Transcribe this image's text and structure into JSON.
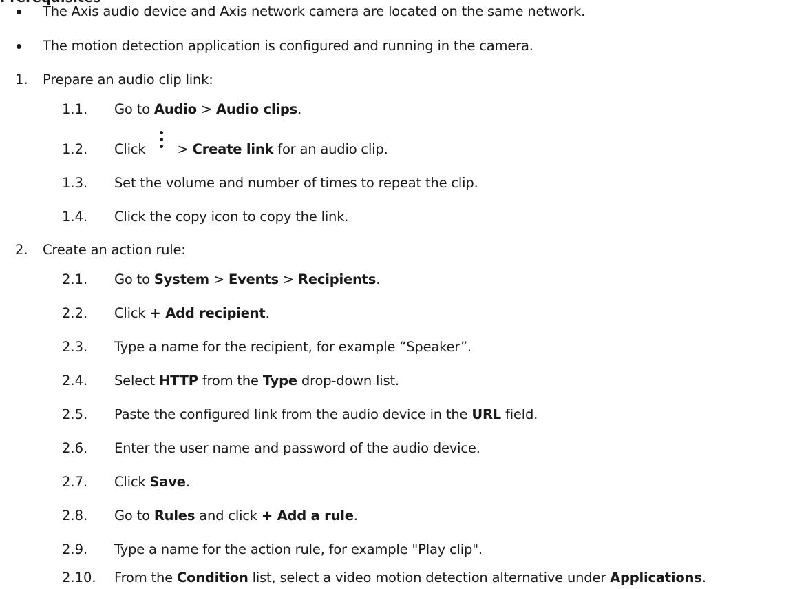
{
  "heading_partial": "Prerequisites",
  "prerequisites": [
    "The Axis audio device and Axis network camera are located on the same network.",
    "The motion detection application is configured and running in the camera."
  ],
  "steps": [
    {
      "num": "1.",
      "text": "Prepare an audio clip link:",
      "substeps": [
        {
          "num": "1.1.",
          "parts": [
            "Go to ",
            "Audio",
            " > ",
            "Audio clips",
            "."
          ]
        },
        {
          "num": "1.2.",
          "parts": [
            "Click ",
            " > ",
            "Create link",
            " for an audio clip."
          ]
        },
        {
          "num": "1.3.",
          "parts": [
            "Set the volume and number of times to repeat the clip."
          ]
        },
        {
          "num": "1.4.",
          "parts": [
            "Click the copy icon to copy the link."
          ]
        }
      ]
    },
    {
      "num": "2.",
      "text": "Create an action rule:",
      "substeps": [
        {
          "num": "2.1.",
          "parts": [
            "Go to ",
            "System",
            " > ",
            "Events",
            " > ",
            "Recipients",
            "."
          ]
        },
        {
          "num": "2.2.",
          "parts": [
            "Click ",
            "+ Add recipient",
            "."
          ]
        },
        {
          "num": "2.3.",
          "parts": [
            "Type a name for the recipient, for example “Speaker”."
          ]
        },
        {
          "num": "2.4.",
          "parts": [
            "Select ",
            "HTTP",
            " from the ",
            "Type",
            " drop-down list."
          ]
        },
        {
          "num": "2.5.",
          "parts": [
            "Paste the configured link from the audio device in the ",
            "URL",
            " field."
          ]
        },
        {
          "num": "2.6.",
          "parts": [
            "Enter the user name and password of the audio device."
          ]
        },
        {
          "num": "2.7.",
          "parts": [
            "Click ",
            "Save",
            "."
          ]
        },
        {
          "num": "2.8.",
          "parts": [
            "Go to ",
            "Rules",
            " and click ",
            "+ Add a rule",
            "."
          ]
        },
        {
          "num": "2.9.",
          "parts": [
            "Type a name for the action rule, for example \"Play clip\"."
          ]
        },
        {
          "num": "2.10.",
          "parts": [
            "From the ",
            "Condition",
            " list, select a video motion detection alternative under ",
            "Applications",
            "."
          ]
        }
      ]
    }
  ],
  "icons": {
    "more_options": "kebab-menu-icon"
  },
  "colors": {
    "text": "#1a1a1a",
    "background": "#ffffff"
  }
}
